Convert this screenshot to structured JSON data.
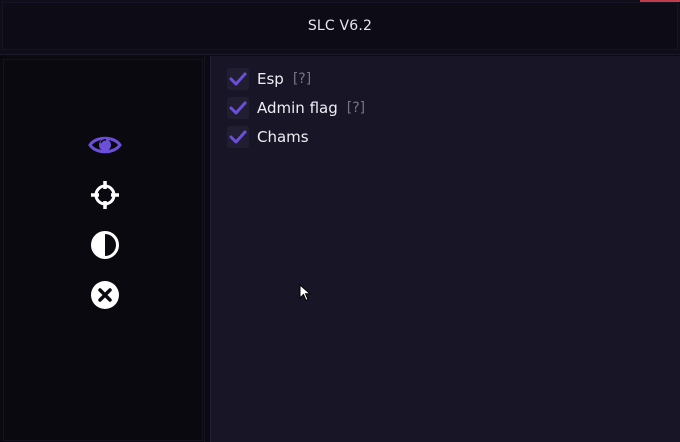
{
  "window": {
    "title": "SLC V6.2"
  },
  "sidebar": {
    "icons": [
      {
        "name": "eye-icon",
        "active": true
      },
      {
        "name": "crosshair-icon",
        "active": false
      },
      {
        "name": "contrast-icon",
        "active": false
      },
      {
        "name": "close-circle-icon",
        "active": false
      }
    ]
  },
  "options": [
    {
      "label": "Esp",
      "checked": true,
      "help": "[?]"
    },
    {
      "label": "Admin flag",
      "checked": true,
      "help": "[?]"
    },
    {
      "label": "Chams",
      "checked": true
    }
  ],
  "colors": {
    "accent": "#6b4fd8",
    "background": "#0b0a12",
    "panel": "#181626",
    "text": "#eeeef4",
    "muted": "#757385"
  }
}
